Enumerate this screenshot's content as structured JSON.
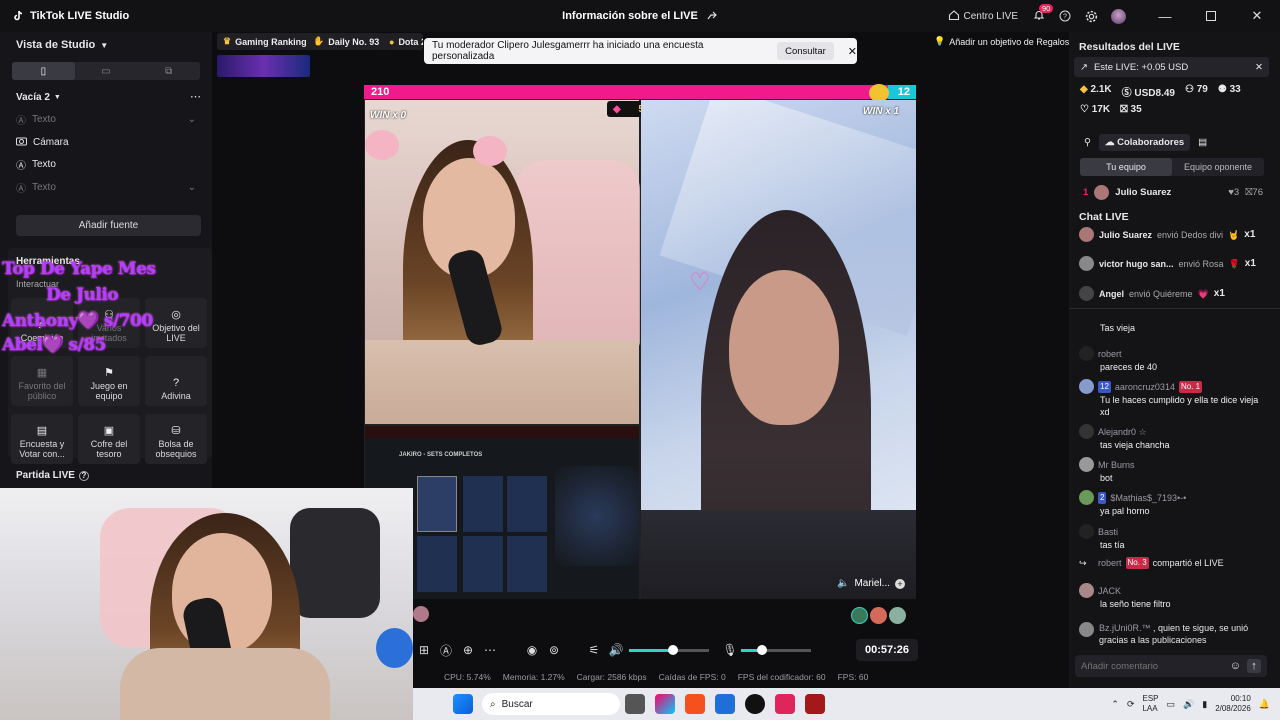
{
  "window": {
    "app_title": "TikTok LIVE Studio",
    "center_title": "Información sobre el LIVE",
    "centro_live": "Centro LIVE",
    "notif_count": "90"
  },
  "left": {
    "studio_view": "Vista de Studio",
    "scene_name": "Vacía 2",
    "sources": [
      "Texto",
      "Cámara",
      "Texto",
      "Texto"
    ],
    "add_source": "Añadir fuente",
    "tools_title": "Herramientas",
    "interact": "Interactuar",
    "tools": [
      "Coemisión",
      "Varios invitados",
      "Objetivo del LIVE",
      "Favorito del público",
      "Juego en equipo",
      "Adivina",
      "Encuesta y Votar con...",
      "Cofre del tesoro",
      "Bolsa de obsequios"
    ],
    "partida": "Partida LIVE"
  },
  "overlay": {
    "line1": "Top De Yape  Mes",
    "line2": "De Julio",
    "line3": "Anthony💜 s/700",
    "line4": "Abel💜       s/85"
  },
  "pills": {
    "gaming_ranking": "Gaming Ranking",
    "daily": "Daily No. 93",
    "dota": "Dota 2",
    "add_goal": "Añadir un objetivo de Regalos"
  },
  "notification": {
    "text": "Tu moderador Clipero Julesgamerrr ha iniciado una encuesta personalizada",
    "button": "Consultar"
  },
  "battle": {
    "score_left": "210",
    "score_right": "12",
    "win_left": "WIN x 0",
    "win_right": "WIN x 1",
    "timer_num": "5",
    "guest_name": "Mariel...",
    "pink_fraction": 0.95
  },
  "game_ui": {
    "header": "JAKIRO - SETS COMPLETOS"
  },
  "controls": {
    "timer": "00:57:26",
    "vol_level": 0.55,
    "mic_level": 0.3
  },
  "stats": {
    "cpu": "CPU:  5.74%",
    "mem": "Memoria:  1.27%",
    "load": "Cargar:  2586 kbps",
    "fps_drop": "Caídas de FPS:  0",
    "enc_fps": "FPS del codificador:  60",
    "fps": "FPS:  60"
  },
  "right": {
    "results_title": "Resultados del LIVE",
    "este_live": "Este LIVE: +0.05 USD",
    "metrics": {
      "diamonds": "2.1K",
      "usd": "USD8.49",
      "people": "79",
      "viewers": "33",
      "likes": "17K",
      "gifts": "35"
    },
    "collab": "Colaboradores",
    "tab_my": "Tu equipo",
    "tab_opp": "Equipo oponente",
    "rank": {
      "pos": "1",
      "name": "Julio Suarez",
      "hearts": "3",
      "gifts": "76"
    },
    "chat_title": "Chat LIVE",
    "gifts": [
      {
        "user": "Julio Suarez",
        "action": "envió Dedos divi",
        "count": "x1"
      },
      {
        "user": "victor hugo san...",
        "action": "envió Rosa",
        "count": "x1"
      },
      {
        "user": "Angel",
        "action": "envió Quiéreme",
        "count": "x1"
      }
    ],
    "chat": [
      {
        "user": "",
        "msg": "Tas vieja"
      },
      {
        "user": "robert",
        "msg": "pareces de 40"
      },
      {
        "user": "aaroncruz0314",
        "level": "12",
        "fan": "No. 1",
        "msg": "Tu le haces cumplido y ella te dice vieja xd"
      },
      {
        "user": "Alejandr0 ☆",
        "msg": "tas vieja chancha"
      },
      {
        "user": "Mr Burns",
        "msg": "bot"
      },
      {
        "user": "$Mathias$_7193•-•",
        "level": "2",
        "msg": "ya pal horno"
      },
      {
        "user": "Basti",
        "msg": "tas tía"
      },
      {
        "user": "robert",
        "fan": "No. 3",
        "msg": "compartió el LIVE"
      },
      {
        "user": "JACK",
        "msg": "la seño tiene filtro"
      },
      {
        "user": "Bz.jUni0R.™",
        "msg": ", quien te sigue, se unió gracias a las publicaciones"
      }
    ],
    "comment_placeholder": "Añadir comentario"
  },
  "taskbar": {
    "search": "Buscar",
    "lang1": "ESP",
    "lang2": "LAA",
    "time": "00:10",
    "date": "2/08/2026"
  },
  "colors": {
    "pink": "#f01a8c",
    "cyan": "#18c8d8",
    "accent": "#2dd4bf"
  }
}
